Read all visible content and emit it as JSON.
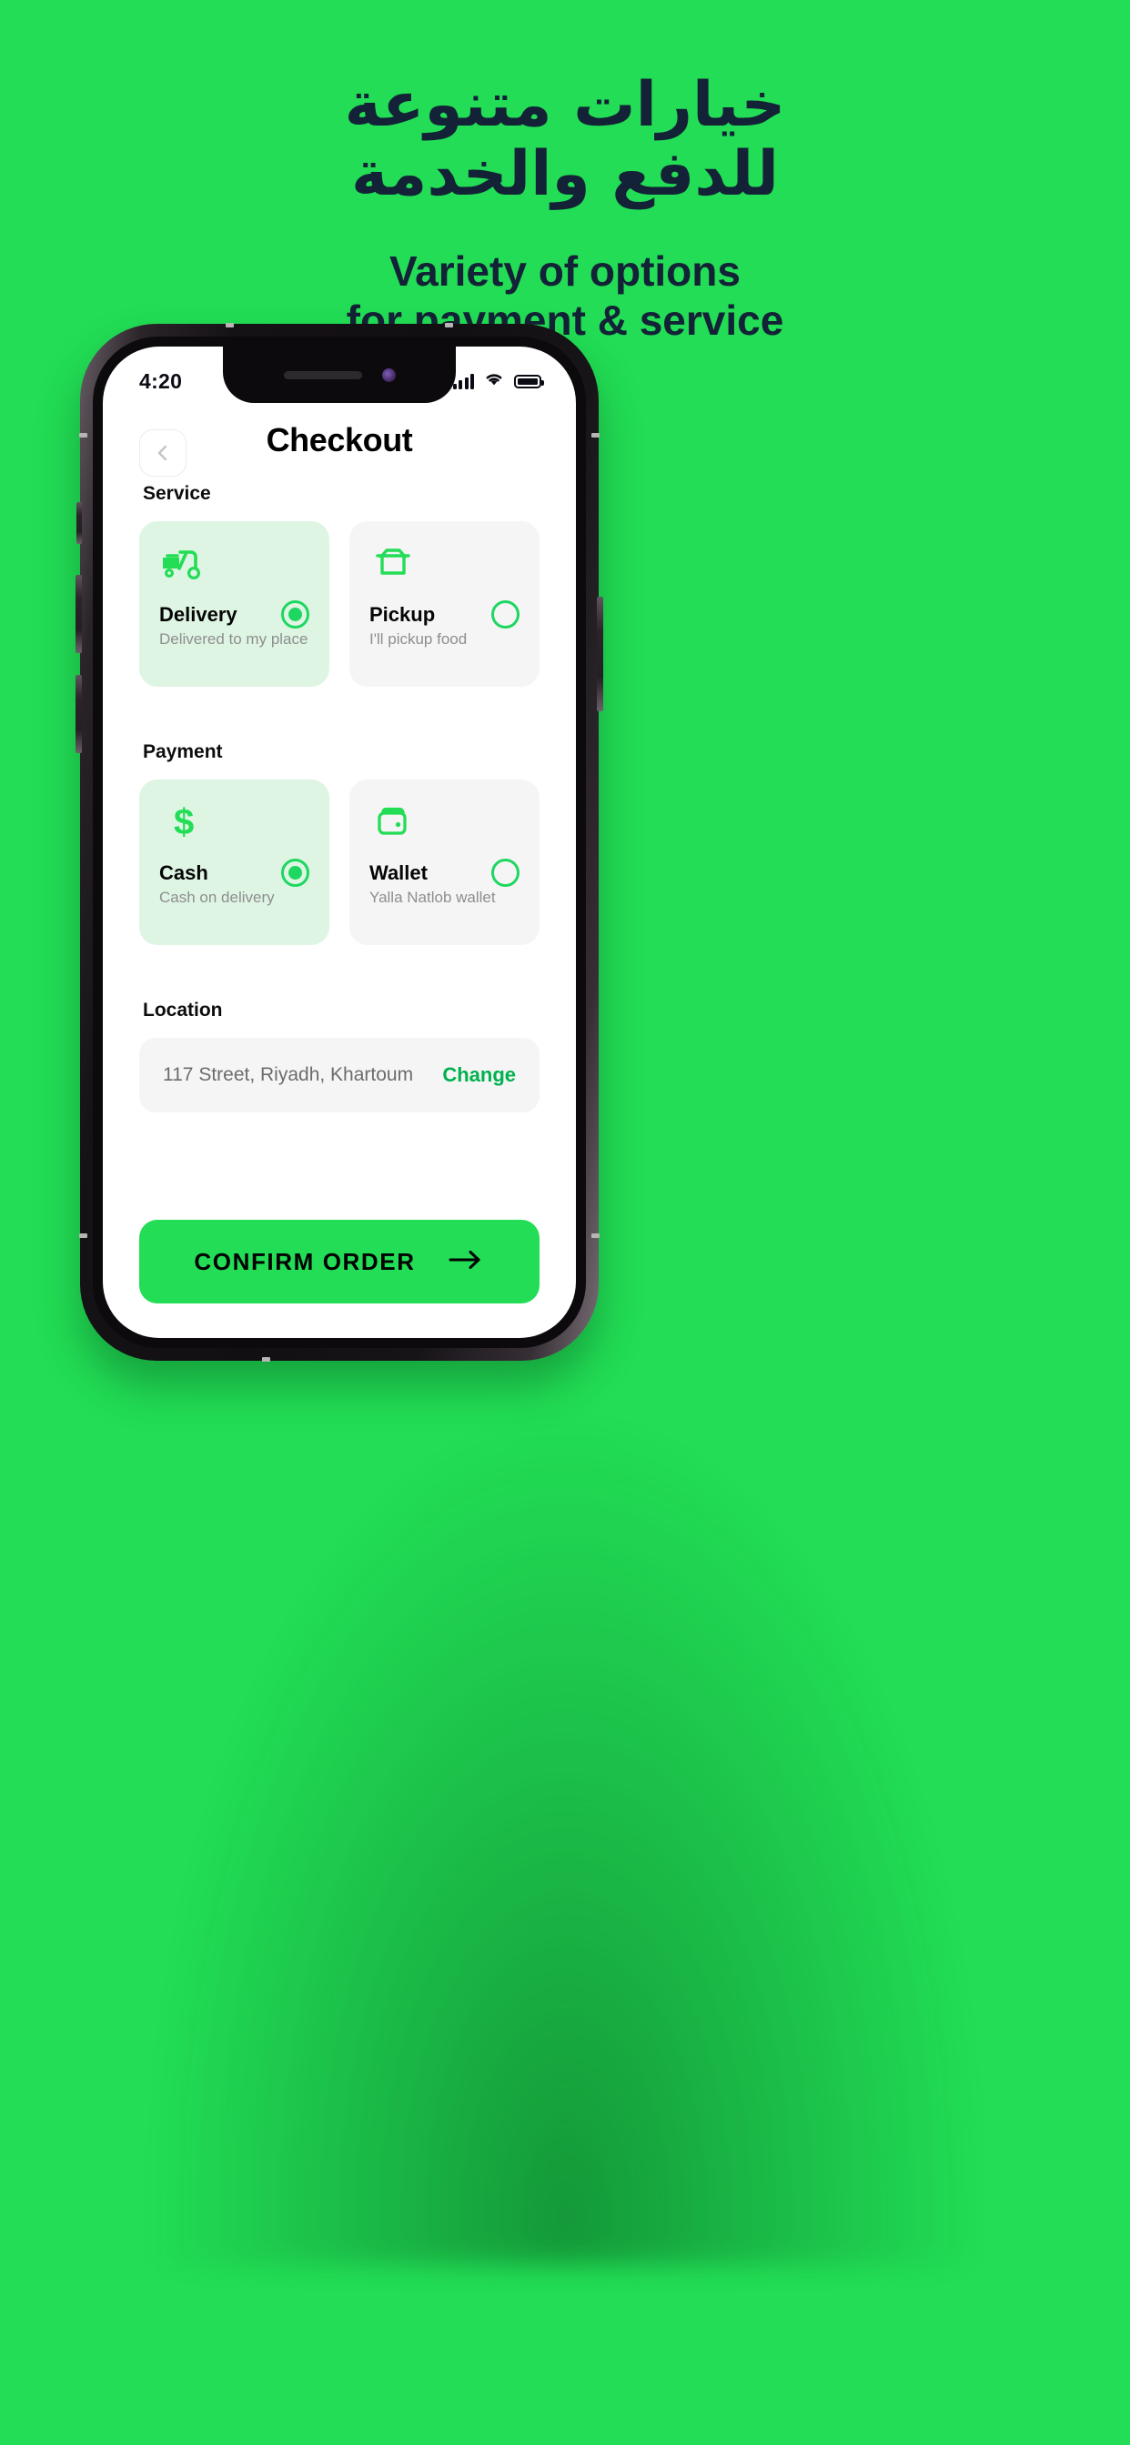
{
  "promo": {
    "headline_ar_line1": "خيارات متنوعة",
    "headline_ar_line2": "للدفع والخدمة",
    "headline_en_line1": "Variety of options",
    "headline_en_line2": "for payment & service",
    "background_color": "#22DD55",
    "text_color": "#132236"
  },
  "status_bar": {
    "time": "4:20",
    "signal_icon": "cellular-signal-icon",
    "wifi_icon": "wifi-icon",
    "battery_icon": "battery-full-icon"
  },
  "app": {
    "title": "Checkout",
    "back_icon": "chevron-left-icon",
    "accent_color": "#1ED760",
    "selected_card_color": "#DEF5E3",
    "unselected_card_color": "#F5F5F5",
    "service": {
      "label": "Service",
      "options": [
        {
          "icon": "scooter-delivery-icon",
          "title": "Delivery",
          "subtitle": "Delivered to my place",
          "selected": true
        },
        {
          "icon": "takeout-box-icon",
          "title": "Pickup",
          "subtitle": "I'll pickup food",
          "selected": false
        }
      ]
    },
    "payment": {
      "label": "Payment",
      "options": [
        {
          "icon": "dollar-sign-icon",
          "title": "Cash",
          "subtitle": "Cash on delivery",
          "selected": true
        },
        {
          "icon": "wallet-icon",
          "title": "Wallet",
          "subtitle": "Yalla Natlob wallet",
          "selected": false
        }
      ]
    },
    "location": {
      "label": "Location",
      "address": "117 Street, Riyadh, Khartoum",
      "change_label": "Change"
    },
    "cta": {
      "label": "CONFIRM ORDER",
      "icon": "arrow-right-icon",
      "color": "#22DD55"
    }
  }
}
